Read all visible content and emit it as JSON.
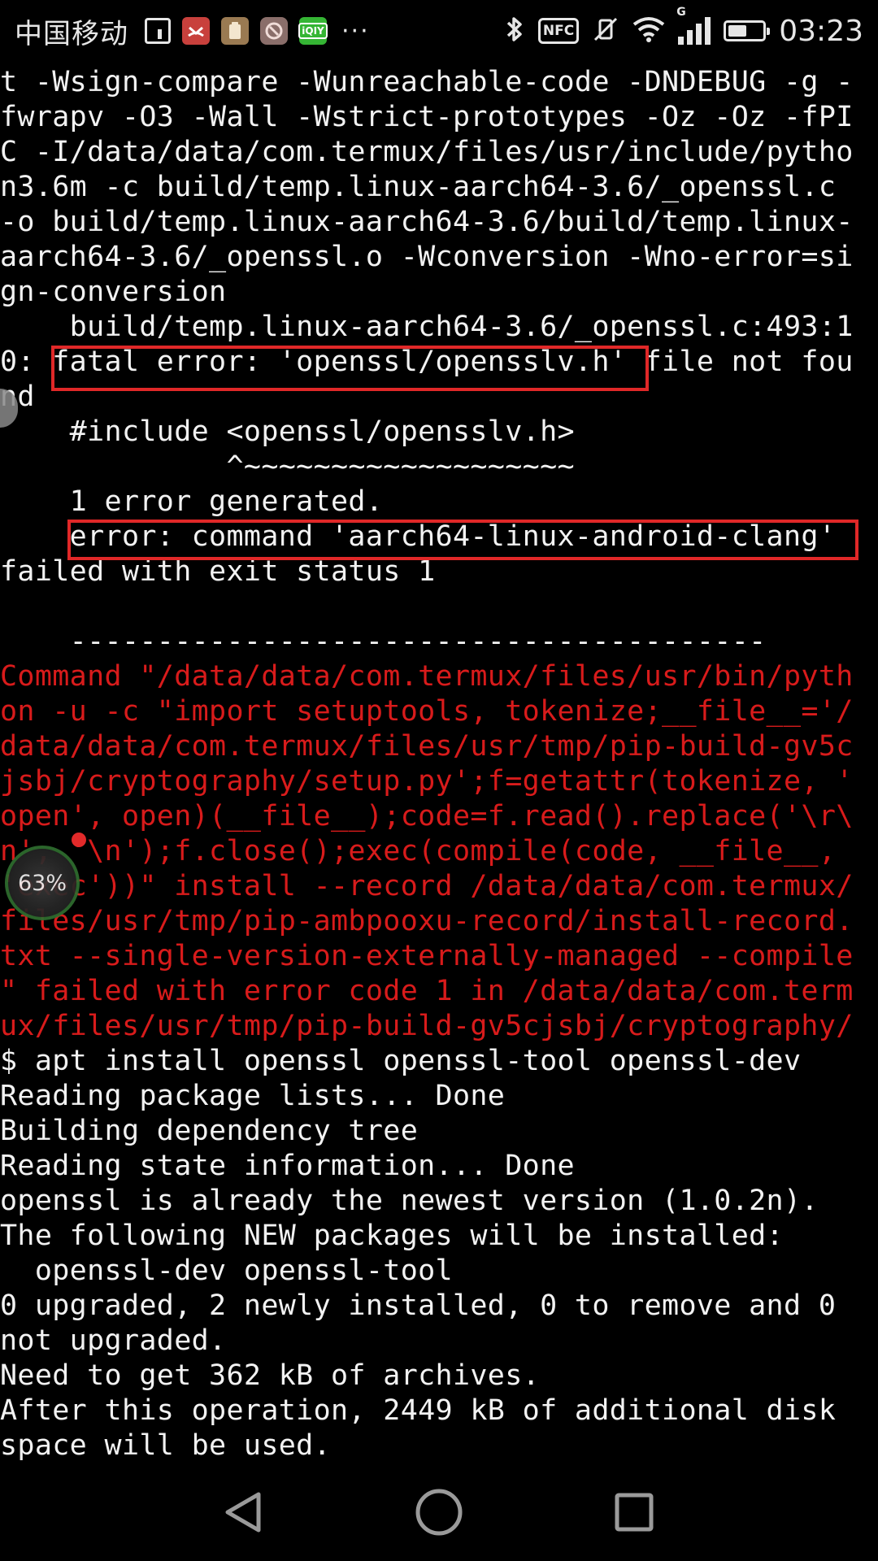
{
  "status_bar": {
    "carrier": "中国移动",
    "notification_icons": [
      "sim-card-icon",
      "phone-missed-icon",
      "clipboard-app-icon",
      "security-app-icon",
      "iqiyi-app-icon"
    ],
    "iqiyi_label": "iQIY",
    "more": "···",
    "right_icons": [
      "bluetooth-icon",
      "nfc-icon",
      "vibrate-off-icon",
      "wifi-icon",
      "signal-icon",
      "battery-icon"
    ],
    "nfc_label": "NFC",
    "network_type": "G",
    "battery_level": 0.55,
    "time": "03:23"
  },
  "terminal": {
    "lines": [
      {
        "text": "t -Wsign-compare -Wunreachable-code -DNDEBUG -g -",
        "style": "normal"
      },
      {
        "text": "fwrapv -O3 -Wall -Wstrict-prototypes -Oz -Oz -fPI",
        "style": "normal"
      },
      {
        "text": "C -I/data/data/com.termux/files/usr/include/pytho",
        "style": "normal"
      },
      {
        "text": "n3.6m -c build/temp.linux-aarch64-3.6/_openssl.c ",
        "style": "normal"
      },
      {
        "text": "-o build/temp.linux-aarch64-3.6/build/temp.linux-",
        "style": "normal"
      },
      {
        "text": "aarch64-3.6/_openssl.o -Wconversion -Wno-error=si",
        "style": "normal"
      },
      {
        "text": "gn-conversion",
        "style": "normal"
      },
      {
        "text": "    build/temp.linux-aarch64-3.6/_openssl.c:493:1",
        "style": "normal"
      },
      {
        "text": "0: fatal error: 'openssl/opensslv.h' file not fou",
        "style": "normal"
      },
      {
        "text": "nd",
        "style": "normal"
      },
      {
        "text": "    #include <openssl/opensslv.h>",
        "style": "normal"
      },
      {
        "text": "             ^~~~~~~~~~~~~~~~~~~~",
        "style": "normal"
      },
      {
        "text": "    1 error generated.",
        "style": "normal"
      },
      {
        "text": "    error: command 'aarch64-linux-android-clang'",
        "style": "normal"
      },
      {
        "text": "failed with exit status 1",
        "style": "normal"
      },
      {
        "text": "",
        "style": "normal"
      },
      {
        "text": "    ----------------------------------------",
        "style": "normal"
      },
      {
        "text": "Command \"/data/data/com.termux/files/usr/bin/pyth",
        "style": "error"
      },
      {
        "text": "on -u -c \"import setuptools, tokenize;__file__='/",
        "style": "error"
      },
      {
        "text": "data/data/com.termux/files/usr/tmp/pip-build-gv5c",
        "style": "error"
      },
      {
        "text": "jsbj/cryptography/setup.py';f=getattr(tokenize, '",
        "style": "error"
      },
      {
        "text": "open', open)(__file__);code=f.read().replace('\\r\\",
        "style": "error"
      },
      {
        "text": "n', '\\n');f.close();exec(compile(code, __file__,",
        "style": "error"
      },
      {
        "text": "'exec'))\" install --record /data/data/com.termux/",
        "style": "error"
      },
      {
        "text": "files/usr/tmp/pip-ambpooxu-record/install-record.",
        "style": "error"
      },
      {
        "text": "txt --single-version-externally-managed --compile",
        "style": "error"
      },
      {
        "text": "\" failed with error code 1 in /data/data/com.term",
        "style": "error"
      },
      {
        "text": "ux/files/usr/tmp/pip-build-gv5cjsbj/cryptography/",
        "style": "error"
      },
      {
        "text": "$ apt install openssl openssl-tool openssl-dev",
        "style": "normal"
      },
      {
        "text": "Reading package lists... Done",
        "style": "normal"
      },
      {
        "text": "Building dependency tree",
        "style": "normal"
      },
      {
        "text": "Reading state information... Done",
        "style": "normal"
      },
      {
        "text": "openssl is already the newest version (1.0.2n).",
        "style": "normal"
      },
      {
        "text": "The following NEW packages will be installed:",
        "style": "normal"
      },
      {
        "text": "  openssl-dev openssl-tool",
        "style": "normal"
      },
      {
        "text": "0 upgraded, 2 newly installed, 0 to remove and 0",
        "style": "normal"
      },
      {
        "text": "not upgraded.",
        "style": "normal"
      },
      {
        "text": "Need to get 362 kB of archives.",
        "style": "normal"
      },
      {
        "text": "After this operation, 2449 kB of additional disk",
        "style": "normal"
      },
      {
        "text": "space will be used.",
        "style": "normal"
      }
    ],
    "highlight_color": "#e02828",
    "text_color": "#f2f2f2",
    "error_color": "#d81b1b"
  },
  "overlay": {
    "float_ball_label": "63%"
  },
  "nav_bar": {
    "icons": [
      "back-icon",
      "home-icon",
      "recent-apps-icon"
    ]
  }
}
